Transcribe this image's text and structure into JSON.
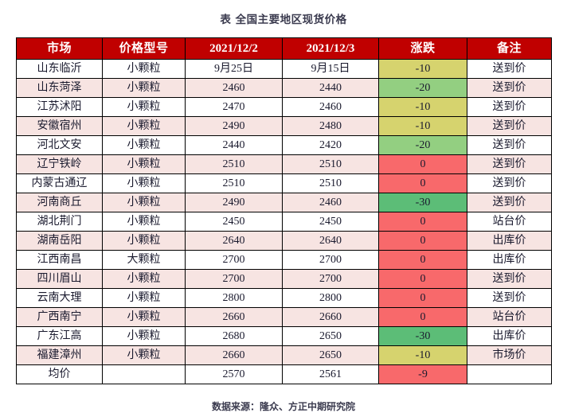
{
  "document": {
    "title": "表  全国主要地区现货价格",
    "source_note": "数据来源：隆众、方正中期研究院"
  },
  "colors": {
    "header_bg": "#C00000",
    "header_text": "#FFFFFF",
    "row_stripe": "#F7E4E2",
    "row_plain": "#FFFFFF",
    "change_zero": "#F8696B",
    "change_minus10": "#D6D36E",
    "change_minus20": "#93CF81",
    "change_minus30": "#5CBD77",
    "grid_line": "#000000"
  },
  "table": {
    "columns": [
      {
        "key": "market",
        "label": "市场"
      },
      {
        "key": "model",
        "label": "价格型号"
      },
      {
        "key": "date1",
        "label": "2021/12/2"
      },
      {
        "key": "date2",
        "label": "2021/12/3"
      },
      {
        "key": "change",
        "label": "涨跌"
      },
      {
        "key": "note",
        "label": "备注"
      }
    ],
    "rows": [
      {
        "market": "山东临沂",
        "model": "小颗粒",
        "date1": "9月25日",
        "date2": "9月15日",
        "change": "-10",
        "change_class": "chg-m10",
        "note": "送到价",
        "stripe": false
      },
      {
        "market": "山东菏泽",
        "model": "小颗粒",
        "date1": "2460",
        "date2": "2440",
        "change": "-20",
        "change_class": "chg-m20",
        "note": "送到价",
        "stripe": true
      },
      {
        "market": "江苏沭阳",
        "model": "小颗粒",
        "date1": "2470",
        "date2": "2460",
        "change": "-10",
        "change_class": "chg-m10",
        "note": "送到价",
        "stripe": false
      },
      {
        "market": "安徽宿州",
        "model": "小颗粒",
        "date1": "2490",
        "date2": "2480",
        "change": "-10",
        "change_class": "chg-m10",
        "note": "送到价",
        "stripe": true
      },
      {
        "market": "河北文安",
        "model": "小颗粒",
        "date1": "2440",
        "date2": "2420",
        "change": "-20",
        "change_class": "chg-m20",
        "note": "送到价",
        "stripe": false
      },
      {
        "market": "辽宁铁岭",
        "model": "小颗粒",
        "date1": "2510",
        "date2": "2510",
        "change": "0",
        "change_class": "chg-zero",
        "note": "送到价",
        "stripe": true
      },
      {
        "market": "内蒙古通辽",
        "model": "小颗粒",
        "date1": "2510",
        "date2": "2510",
        "change": "0",
        "change_class": "chg-zero",
        "note": "送到价",
        "stripe": false
      },
      {
        "market": "河南商丘",
        "model": "小颗粒",
        "date1": "2490",
        "date2": "2460",
        "change": "-30",
        "change_class": "chg-m30",
        "note": "送到价",
        "stripe": true
      },
      {
        "market": "湖北荆门",
        "model": "小颗粒",
        "date1": "2450",
        "date2": "2450",
        "change": "0",
        "change_class": "chg-zero",
        "note": "站台价",
        "stripe": false
      },
      {
        "market": "湖南岳阳",
        "model": "小颗粒",
        "date1": "2640",
        "date2": "2640",
        "change": "0",
        "change_class": "chg-zero",
        "note": "出库价",
        "stripe": true
      },
      {
        "market": "江西南昌",
        "model": "大颗粒",
        "date1": "2700",
        "date2": "2700",
        "change": "0",
        "change_class": "chg-zero",
        "note": "出库价",
        "stripe": false
      },
      {
        "market": "四川眉山",
        "model": "小颗粒",
        "date1": "2700",
        "date2": "2700",
        "change": "0",
        "change_class": "chg-zero",
        "note": "送到价",
        "stripe": true
      },
      {
        "market": "云南大理",
        "model": "小颗粒",
        "date1": "2800",
        "date2": "2800",
        "change": "0",
        "change_class": "chg-zero",
        "note": "送到价",
        "stripe": false
      },
      {
        "market": "广西南宁",
        "model": "小颗粒",
        "date1": "2660",
        "date2": "2660",
        "change": "0",
        "change_class": "chg-zero",
        "note": "站台价",
        "stripe": true
      },
      {
        "market": "广东江高",
        "model": "小颗粒",
        "date1": "2680",
        "date2": "2650",
        "change": "-30",
        "change_class": "chg-m30",
        "note": "出库价",
        "stripe": false
      },
      {
        "market": "福建漳州",
        "model": "小颗粒",
        "date1": "2660",
        "date2": "2650",
        "change": "-10",
        "change_class": "chg-m10",
        "note": "市场价",
        "stripe": true
      }
    ],
    "summary_row": {
      "market": "均价",
      "model": "",
      "date1": "2570",
      "date2": "2561",
      "change": "-9",
      "change_class": "chg-m9",
      "note": ""
    }
  }
}
